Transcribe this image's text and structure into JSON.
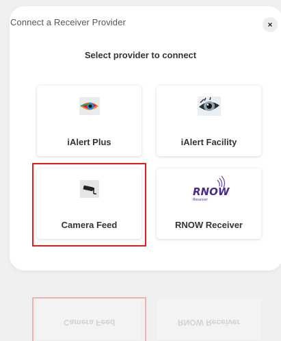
{
  "dialog": {
    "title": "Connect a Receiver Provider",
    "close_label": "×",
    "subtitle": "Select provider to connect"
  },
  "providers": [
    {
      "label": "iAlert Plus",
      "icon": "eye-color-icon",
      "selected": false
    },
    {
      "label": "iAlert Facility",
      "icon": "eye-dark-icon",
      "selected": false
    },
    {
      "label": "Camera Feed",
      "icon": "security-camera-icon",
      "selected": true
    },
    {
      "label": "RNOW Receiver",
      "icon": "rnow-logo-icon",
      "logo_text": "RNOW",
      "logo_sub": "Receiver",
      "selected": false
    }
  ],
  "colors": {
    "selection": "#e8191a",
    "rnow_purple": "#4a2b8c"
  }
}
